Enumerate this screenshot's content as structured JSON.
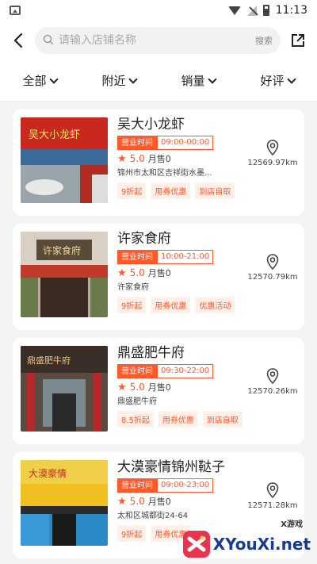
{
  "status_bar": {
    "time": "11:13"
  },
  "search": {
    "placeholder": "请输入店铺名称",
    "button_label": "搜索"
  },
  "filters": [
    {
      "label": "全部"
    },
    {
      "label": "附近"
    },
    {
      "label": "销量"
    },
    {
      "label": "好评"
    }
  ],
  "stores": [
    {
      "name": "吴大小龙虾",
      "hours_label": "营业时间",
      "hours": "09:00-00:00",
      "score": "5.0",
      "sales": "月售0",
      "address": "锦州市太和区吉祥街水墨...",
      "distance": "12569.97km",
      "tags": [
        "9折起",
        "用券优惠",
        "到店自取"
      ],
      "sign_text": "吴大小龙虾"
    },
    {
      "name": "许家食府",
      "hours_label": "营业时间",
      "hours": "10:00-21:00",
      "score": "5.0",
      "sales": "月售0",
      "address": "许家食府",
      "distance": "12570.79km",
      "tags": [
        "9折起",
        "用券优惠",
        "优惠活动"
      ],
      "sign_text": "许家食府"
    },
    {
      "name": "鼎盛肥牛府",
      "hours_label": "营业时间",
      "hours": "09:30-22:00",
      "score": "5.0",
      "sales": "月售0",
      "address": "鼎盛肥牛府",
      "distance": "12570.26km",
      "tags": [
        "8.5折起",
        "用券优惠",
        "到店自取"
      ],
      "sign_text": "鼎盛肥牛府"
    },
    {
      "name": "大漠豪情锦州鞑子",
      "hours_label": "营业时间",
      "hours": "09:00-23:00",
      "score": "5.0",
      "sales": "月售0",
      "address": "太和区城都街24-64",
      "distance": "12571.28km",
      "tags": [
        "9折起",
        "用券优惠"
      ],
      "sign_text": "大漠豪情"
    }
  ],
  "watermark": {
    "text": "XYouXi.net",
    "small": "X游戏"
  },
  "colors": {
    "accent": "#ff5a2c",
    "accent_light": "#fff0ea"
  }
}
